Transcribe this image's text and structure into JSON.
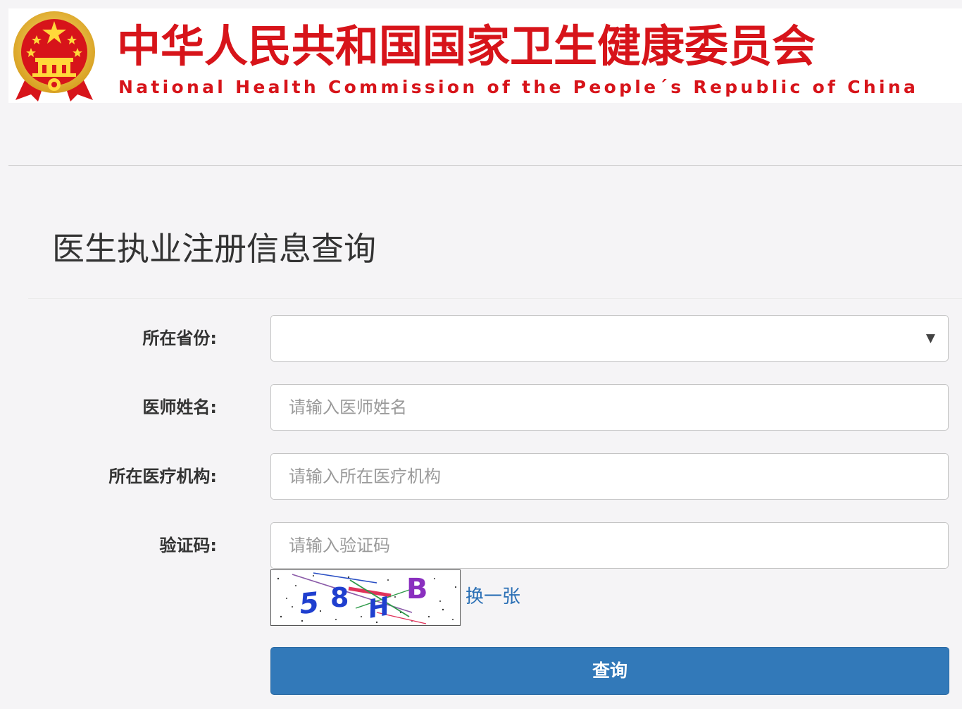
{
  "header": {
    "title_cn": "中华人民共和国国家卫生健康委员会",
    "title_en": "National Health Commission of the People´s Republic of China",
    "emblem_icon": "national-emblem-icon",
    "brand_color": "#d7141a"
  },
  "page": {
    "title": "医生执业注册信息查询"
  },
  "form": {
    "province": {
      "label": "所在省份:",
      "value": "",
      "arrow_icon": "caret-down-icon",
      "arrow": "▼"
    },
    "doctor_name": {
      "label": "医师姓名:",
      "value": "",
      "placeholder": "请输入医师姓名"
    },
    "institution": {
      "label": "所在医疗机构:",
      "value": "",
      "placeholder": "请输入所在医疗机构"
    },
    "captcha": {
      "label": "验证码:",
      "value": "",
      "placeholder": "请输入验证码",
      "image_text": "58HB",
      "refresh_label": "换一张"
    },
    "submit_label": "查询"
  },
  "colors": {
    "page_bg": "#f5f4f6",
    "link": "#2a6fb5",
    "button": "#3279b9"
  }
}
